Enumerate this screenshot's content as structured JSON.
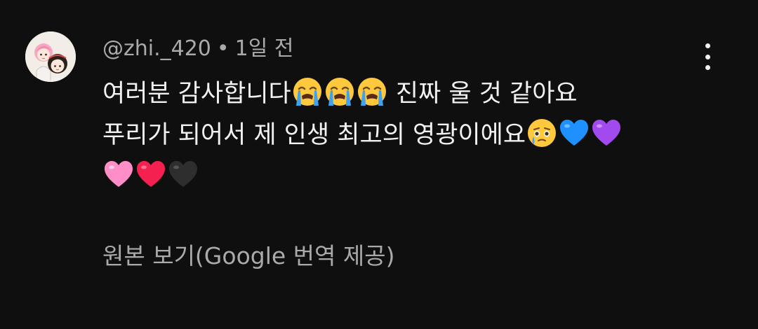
{
  "comment": {
    "author": "@zhi._420",
    "separator": "•",
    "timestamp": "1일 전",
    "lines": [
      {
        "text": "여러분 감사합니다",
        "emojis": [
          "loudly-crying-face-emoji",
          "loudly-crying-face-emoji",
          "loudly-crying-face-emoji"
        ],
        "after": " 진짜 울 것 같아요"
      },
      {
        "text": "푸리가 되어서 제 인생 최고의 영광이에요",
        "emojis": [
          "face-holding-back-tears-emoji",
          "blue-heart-emoji",
          "purple-heart-emoji"
        ]
      },
      {
        "emojis": [
          "pink-heart-emoji",
          "red-heart-emoji",
          "black-heart-emoji"
        ]
      }
    ],
    "translate_label": "원본 보기(Google 번역 제공)"
  },
  "icons": {
    "more": "more-vertical-icon",
    "avatar": "user-avatar"
  },
  "colors": {
    "background": "#0f0f0f",
    "primary_text": "#f1f1f1",
    "secondary_text": "#aaaaaa"
  }
}
